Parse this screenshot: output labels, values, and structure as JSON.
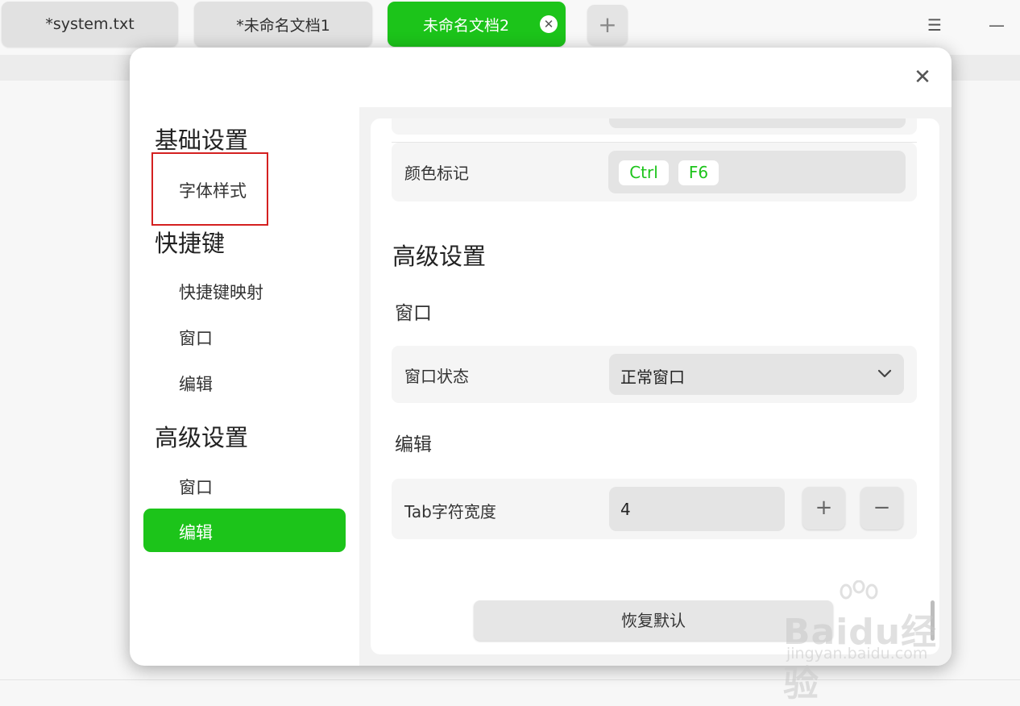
{
  "tabs": [
    {
      "label": "*system.txt",
      "active": false
    },
    {
      "label": "*未命名文档1",
      "active": false
    },
    {
      "label": "未命名文档2",
      "active": true
    }
  ],
  "tab_close_icon": "close-circle-icon",
  "add_tab_icon": "plus-icon",
  "window_controls": {
    "menu_icon": "menu-icon",
    "minimize_icon": "minimize-icon"
  },
  "accent_color": "#1cc41a",
  "dialog": {
    "close_icon": "close-icon",
    "sidebar": {
      "basic_heading": "基础设置",
      "font_style": "字体样式",
      "shortcut_heading": "快捷键",
      "shortcut_map": "快捷键映射",
      "shortcut_window": "窗口",
      "shortcut_edit": "编辑",
      "advanced_heading": "高级设置",
      "advanced_window": "窗口",
      "advanced_edit": "编辑",
      "selected": "编辑"
    },
    "content": {
      "color_mark_label": "颜色标记",
      "color_mark_keys": [
        "Ctrl",
        "F6"
      ],
      "advanced_title": "高级设置",
      "window_section": "窗口",
      "window_state_label": "窗口状态",
      "window_state_value": "正常窗口",
      "edit_section": "编辑",
      "tab_width_label": "Tab字符宽度",
      "tab_width_value": "4",
      "increase_label": "+",
      "decrease_label": "−",
      "restore_label": "恢复默认"
    }
  },
  "watermark": {
    "brand": "Baidu经验",
    "sub": "jingyan.baidu.com"
  }
}
